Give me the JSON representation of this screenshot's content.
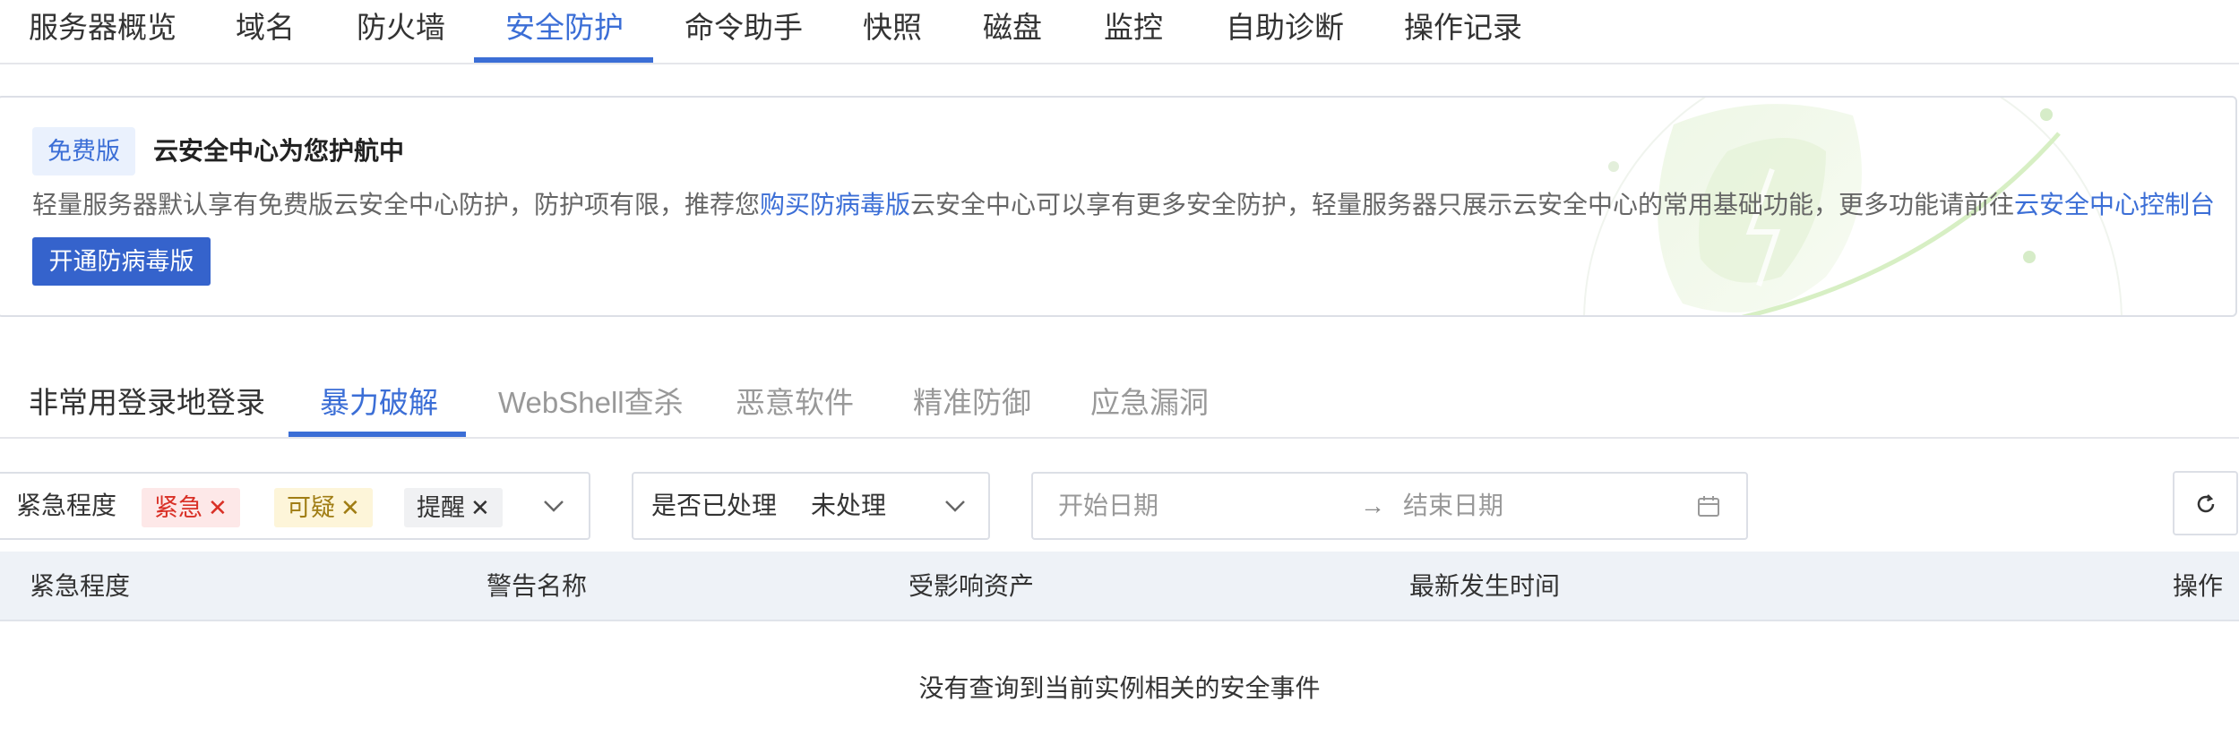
{
  "top_tabs": [
    "服务器概览",
    "域名",
    "防火墙",
    "安全防护",
    "命令助手",
    "快照",
    "磁盘",
    "监控",
    "自助诊断",
    "操作记录"
  ],
  "promo": {
    "badge": "免费版",
    "title": "云安全中心为您护航中",
    "desc_1": "轻量服务器默认享有免费版云安全中心防护，防护项有限，推荐您",
    "link_buy": "购买防病毒版",
    "desc_2": "云安全中心可以享有更多安全防护，轻量服务器只展示云安全中心的常用基础功能，更多功能请前往",
    "link_console": "云安全中心控制台",
    "button": "开通防病毒版"
  },
  "sub_tabs": [
    "非常用登录地登录",
    "暴力破解",
    "WebShell查杀",
    "恶意软件",
    "精准防御",
    "应急漏洞"
  ],
  "filters": {
    "urgency_label": "紧急程度",
    "tags": [
      "紧急",
      "可疑",
      "提醒"
    ],
    "tag_close": "✕",
    "processed_label": "是否已处理",
    "processed_value": "未处理",
    "start_placeholder": "开始日期",
    "arrow": "→",
    "end_placeholder": "结束日期"
  },
  "table": {
    "columns": [
      "紧急程度",
      "警告名称",
      "受影响资产",
      "最新发生时间",
      "操作"
    ],
    "empty": "没有查询到当前实例相关的安全事件"
  },
  "colors": {
    "accent": "#3b6ed6",
    "button": "#3563cc",
    "urgent": "#d93026",
    "suspicious": "#a07d14"
  },
  "icons": [
    "chevron-down-icon",
    "calendar-icon",
    "refresh-icon",
    "close-icon"
  ]
}
